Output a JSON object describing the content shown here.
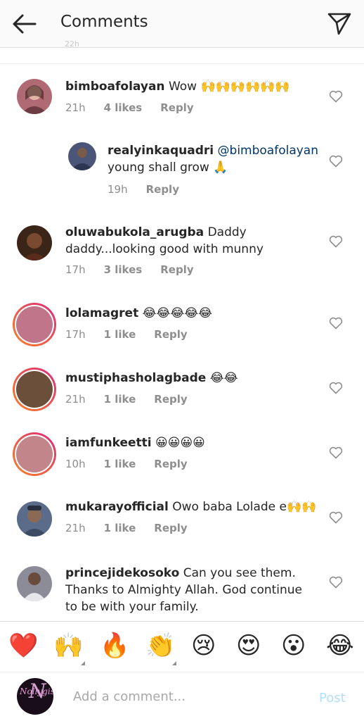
{
  "header": {
    "title": "Comments",
    "back_icon": "back-arrow-icon",
    "send_icon": "paper-plane-icon"
  },
  "peek_text": "22h",
  "comments": [
    {
      "username": "bimboafolayan",
      "text": "Wow 🙌🙌🙌🙌🙌🙌",
      "time": "21h",
      "likes": "4 likes",
      "reply": "Reply",
      "avatar_color": "#b06a74"
    },
    {
      "username": "realyinkaquadri",
      "mention": "@bimboafolayan",
      "text": "young shall grow 🙏",
      "time": "19h",
      "reply": "Reply",
      "avatar_color": "#4a5578"
    },
    {
      "username": "oluwabukola_arugba",
      "text": "Daddy daddy...looking good with munny",
      "time": "17h",
      "likes": "3 likes",
      "reply": "Reply",
      "avatar_color": "#3b2418"
    },
    {
      "username": "lolamagret",
      "text": "😂😂😂😂😂",
      "time": "17h",
      "likes": "1 like",
      "reply": "Reply",
      "avatar_color": "#c0758b"
    },
    {
      "username": "mustiphasholagbade",
      "text": "😂😂",
      "time": "21h",
      "likes": "1 like",
      "reply": "Reply",
      "avatar_color": "#6b4f3b"
    },
    {
      "username": "iamfunkeetti",
      "text": "😀😀😀😀",
      "time": "10h",
      "likes": "1 like",
      "reply": "Reply",
      "avatar_color": "#c2868a"
    },
    {
      "username": "mukarayofficial",
      "text": "Owo baba Lolade e🙌🙌",
      "time": "21h",
      "likes": "1 like",
      "reply": "Reply",
      "avatar_color": "#5a6c8a"
    },
    {
      "username": "princejidekosoko",
      "text": "Can you see them. Thanks to Almighty Allah. God continue to be with your family.",
      "avatar_color": "#8c8b98"
    }
  ],
  "quick_reactions": [
    "❤️",
    "🙌",
    "🔥",
    "👏",
    "😢",
    "😍",
    "😮",
    "😂"
  ],
  "composer": {
    "placeholder": "Add a comment...",
    "post_label": "Post",
    "avatar_script": "Nollygisto",
    "avatar_letter": "N"
  },
  "colors": {
    "accent_disabled": "#b2dffc",
    "mention": "#003569",
    "meta": "#8e8e8e",
    "story_ring_start": "#f58529",
    "story_ring_end": "#dd2a7b"
  }
}
